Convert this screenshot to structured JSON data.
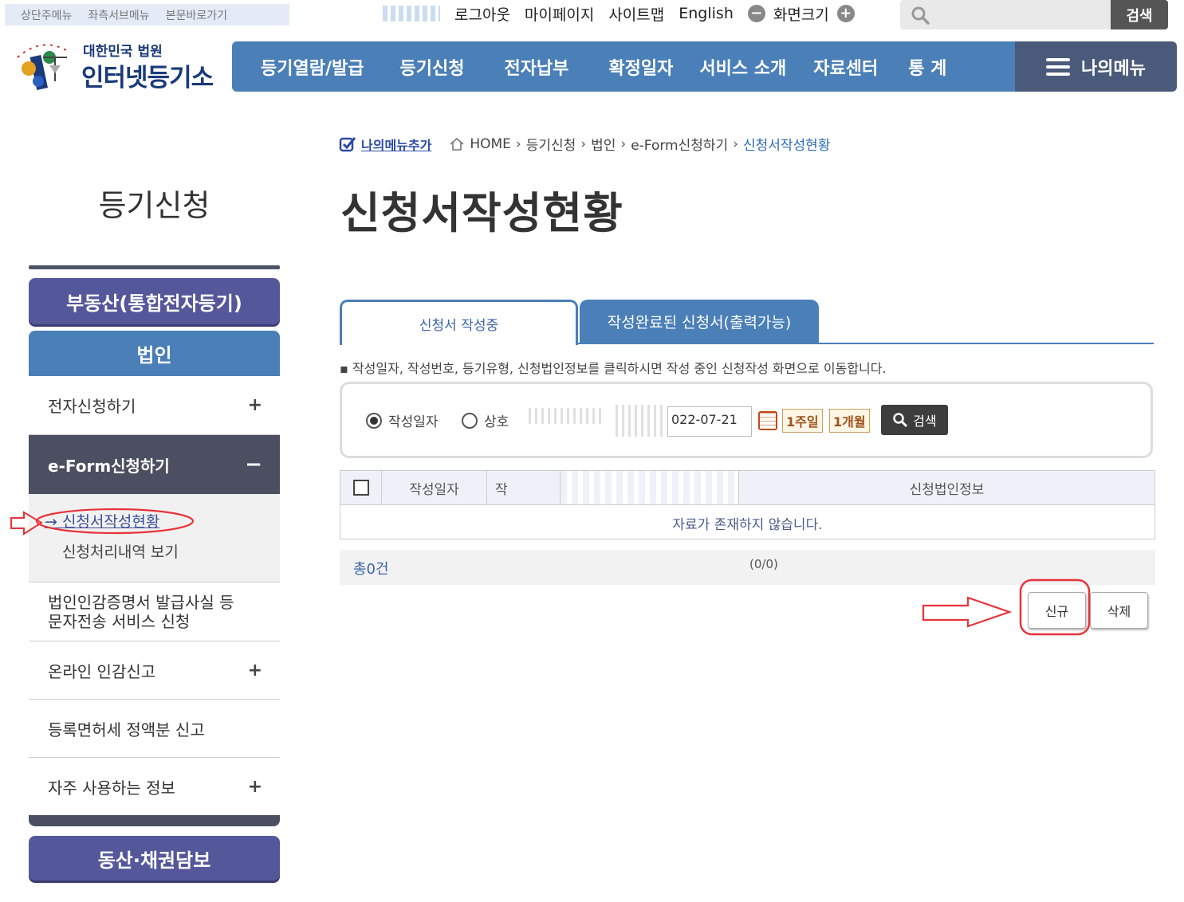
{
  "skip_links": [
    "상단주메뉴",
    "좌측서브메뉴",
    "본문바로가기"
  ],
  "util": {
    "logout": "로그아웃",
    "mypage": "마이페이지",
    "sitemap": "사이트맵",
    "english": "English",
    "zoom_label": "화면크기",
    "search_button": "검색"
  },
  "logo": {
    "line1": "대한민국 법원",
    "line2": "인터넷등기소"
  },
  "gnb": [
    "등기열람/발급",
    "등기신청",
    "전자납부",
    "확정일자",
    "서비스 소개",
    "자료센터",
    "통 계"
  ],
  "mymenu": "나의메뉴",
  "sidebar": {
    "title": "등기신청",
    "realestate": "부동산(통합전자등기)",
    "corp": "법인",
    "items": [
      {
        "label": "전자신청하기",
        "toggle": "+"
      },
      {
        "label": "e-Form신청하기",
        "toggle": "−"
      },
      {
        "label": "법인인감증명서 발급사실 등 문자전송 서비스 신청"
      },
      {
        "label": "온라인 인감신고",
        "toggle": "+"
      },
      {
        "label": "등록면허세 정액분 신고"
      },
      {
        "label": "자주 사용하는 정보",
        "toggle": "+"
      }
    ],
    "sub": [
      "신청서작성현황",
      "신청처리내역 보기"
    ],
    "movable": "동산·채권담보"
  },
  "breadcrumb": {
    "add_mymenu": "나의메뉴추가",
    "items": [
      "HOME",
      "등기신청",
      "법인",
      "e-Form신청하기",
      "신청서작성현황"
    ]
  },
  "page_title": "신청서작성현황",
  "tabs": [
    "신청서 작성중",
    "작성완료된 신청서(출력가능)"
  ],
  "note": "작성일자, 작성번호, 등기유형, 신청법인정보를 클릭하시면 작성 중인 신청작성 화면으로 이동합니다.",
  "search": {
    "radio_date": "작성일자",
    "radio_name": "상호",
    "date_end": "022-07-21",
    "week_btn": "1주일",
    "month_btn": "1개월",
    "search_btn": "검색"
  },
  "table": {
    "headers": [
      "작성일자",
      "작",
      "",
      "신청법인정보"
    ],
    "empty": "자료가 존재하지 않습니다."
  },
  "footer": {
    "total": "총0건",
    "pager": "(0/0)"
  },
  "actions": {
    "new": "신규",
    "delete": "삭제"
  },
  "colors": {
    "gnb": "#4a7fb8",
    "purple": "#55579b",
    "dark": "#4b4f61",
    "annotation": "#e8333a"
  }
}
